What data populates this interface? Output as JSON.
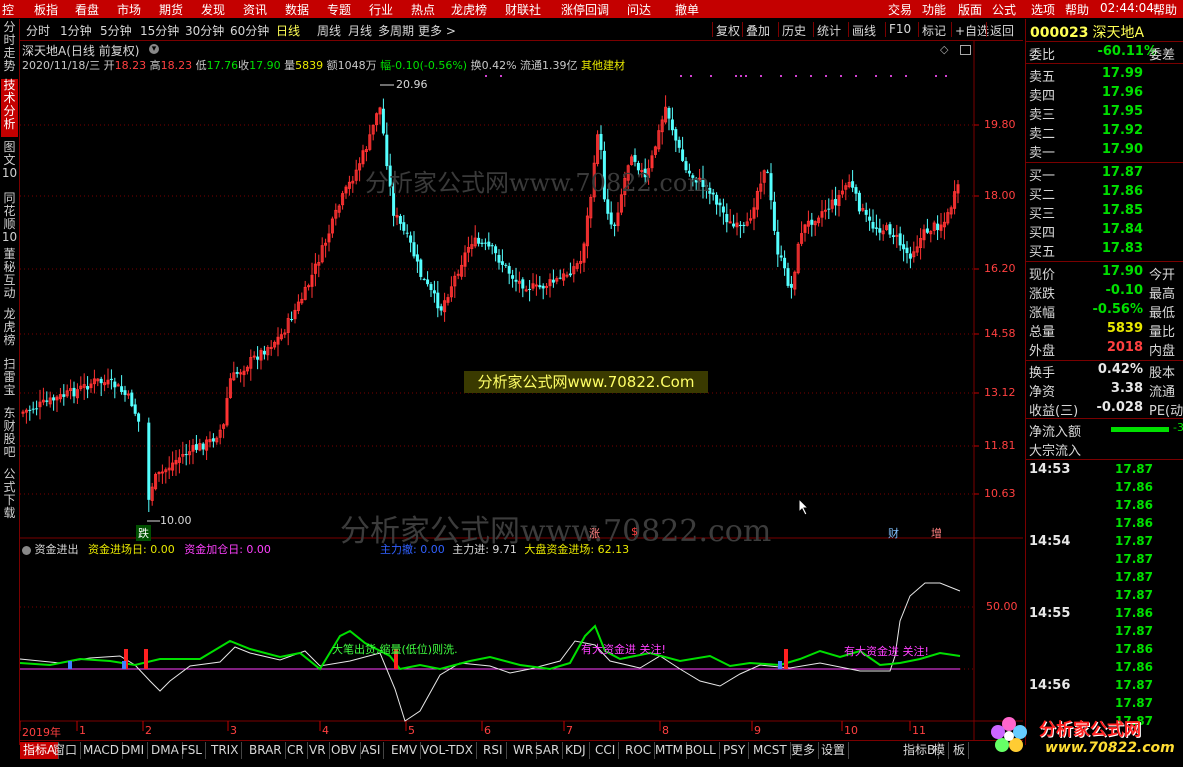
{
  "top_menu": [
    "控",
    "板指",
    "看盘",
    "市场",
    "期货",
    "发现",
    "资讯",
    "数据",
    "专题",
    "行业",
    "热点",
    "龙虎榜",
    "财联社",
    "涨停回调",
    "问达",
    "撤单",
    "交易",
    "功能",
    "版面",
    "公式",
    "选项",
    "帮助",
    "02:44:04",
    "帮助"
  ],
  "toolbar": {
    "periods": [
      "分时",
      "1分钟",
      "5分钟",
      "15分钟",
      "30分钟",
      "60分钟",
      "日线",
      "周线",
      "月线",
      "多周期",
      "更多 >"
    ],
    "active_period": "日线",
    "actions": [
      "复权",
      "叠加",
      "历史",
      "统计",
      "画线",
      "F10",
      "标记",
      "+自选",
      "返回"
    ]
  },
  "left_tabs": [
    {
      "label": "分时走势",
      "active": false
    },
    {
      "label": "技术分析",
      "active": true
    },
    {
      "label": "图文10",
      "active": false
    },
    {
      "label": "同花顺10",
      "active": false
    },
    {
      "label": "董秘互动",
      "active": false
    },
    {
      "label": "龙虎榜",
      "active": false
    },
    {
      "label": "扫雷宝",
      "active": false
    },
    {
      "label": "东财股吧",
      "active": false
    },
    {
      "label": "公式下载",
      "active": false
    }
  ],
  "chart_header": {
    "stock": "深天地A(日线 前复权)",
    "date": "2020/11/18/三",
    "open_label": "开",
    "open": "18.23",
    "high_label": "高",
    "high": "18.23",
    "low_label": "低",
    "low": "17.76",
    "close_label": "收",
    "close": "17.90",
    "vol_label": "量",
    "volume": "5839",
    "amount": "额1048万",
    "change": "幅-0.10(-0.56%)",
    "turnover": "换0.42%",
    "float_cap": "流通1.39亿",
    "other": "其他建材"
  },
  "watermark_center": "分析家公式网www.70822.Com",
  "watermark_big": "分析家公式网www.70822.com",
  "watermark_upper": "分析家公式网www.70822.com",
  "price_labels": {
    "max": "20.96",
    "min": "10.00"
  },
  "event_marks": {
    "die": "跌",
    "zhang": "涨",
    "s": "$",
    "cai": "财",
    "zeng": "增"
  },
  "indicator_header": {
    "name": "资金进出",
    "entry_day": "资金进场日: 0.00",
    "add_day": "资金加仓日: 0.00",
    "main_sell": "主力撤: 0.00",
    "main_in": "主力进: 9.71",
    "market_in": "大盘资金进场: 62.13"
  },
  "indicator_texts": {
    "t1": "大笔出货,缩量(低位)则洗.",
    "t2": "有大资金进 关注!",
    "t3": "有大资金进 关注!"
  },
  "indicator_axis": "50.00",
  "price_axis": [
    "19.80",
    "18.00",
    "16.20",
    "14.58",
    "13.12",
    "11.81",
    "10.63"
  ],
  "x_axis": [
    "2019年",
    "1",
    "2",
    "3",
    "4",
    "5",
    "6",
    "7",
    "8",
    "9",
    "10",
    "11"
  ],
  "bottom_tabs": [
    "指标A",
    "窗口",
    "MACD",
    "DMI",
    "DMA",
    "FSL",
    "TRIX",
    "BRAR",
    "CR",
    "VR",
    "OBV",
    "ASI",
    "EMV",
    "VOL-TDX",
    "RSI",
    "WR",
    "SAR",
    "KDJ",
    "CCI",
    "ROC",
    "MTM",
    "BOLL",
    "PSY",
    "MCST",
    "更多",
    "设置",
    "指标B",
    "模",
    "板"
  ],
  "right_panel": {
    "code": "000023",
    "name": "深天地A",
    "webi_label": "委比",
    "webi": "-60.11%",
    "webi_ex": "委差",
    "asks": [
      {
        "label": "卖五",
        "price": "17.99"
      },
      {
        "label": "卖四",
        "price": "17.96"
      },
      {
        "label": "卖三",
        "price": "17.95"
      },
      {
        "label": "卖二",
        "price": "17.92"
      },
      {
        "label": "卖一",
        "price": "17.90"
      }
    ],
    "bids": [
      {
        "label": "买一",
        "price": "17.87"
      },
      {
        "label": "买二",
        "price": "17.86"
      },
      {
        "label": "买三",
        "price": "17.85"
      },
      {
        "label": "买四",
        "price": "17.84"
      },
      {
        "label": "买五",
        "price": "17.83"
      }
    ],
    "stats": [
      {
        "label": "现价",
        "value": "17.90",
        "ex": "今开",
        "color": "#00e000"
      },
      {
        "label": "涨跌",
        "value": "-0.10",
        "ex": "最高",
        "color": "#00e000"
      },
      {
        "label": "涨幅",
        "value": "-0.56%",
        "ex": "最低",
        "color": "#00e000"
      },
      {
        "label": "总量",
        "value": "5839",
        "ex": "量比",
        "color": "#e8e800"
      },
      {
        "label": "外盘",
        "value": "2018",
        "ex": "内盘",
        "color": "#ff4040"
      }
    ],
    "stats2": [
      {
        "label": "换手",
        "value": "0.42%",
        "ex": "股本",
        "color": "#e8e8e8"
      },
      {
        "label": "净资",
        "value": "3.38",
        "ex": "流通",
        "color": "#e8e8e8"
      },
      {
        "label": "收益(三)",
        "value": "-0.028",
        "ex": "PE(动",
        "color": "#e8e8e8"
      }
    ],
    "netflow_label": "净流入额",
    "netflow_val": "-3",
    "bigorder_label": "大宗流入",
    "ticks": [
      {
        "time": "14:53",
        "prices": [
          "17.87",
          "17.86",
          "17.86",
          "17.86"
        ]
      },
      {
        "time": "14:54",
        "prices": [
          "17.87",
          "17.87",
          "17.87",
          "17.87"
        ]
      },
      {
        "time": "14:55",
        "prices": [
          "17.86",
          "17.87",
          "17.86",
          "17.86"
        ]
      },
      {
        "time": "14:56",
        "prices": [
          "17.87",
          "17.87",
          "17.87"
        ]
      }
    ]
  },
  "logo": {
    "text": "分析家公式网",
    "url": "www.70822.com"
  },
  "colors": {
    "accent": "#c40000",
    "up": "#ff3232",
    "down": "#54ffff",
    "green": "#00e000",
    "yellow": "#e8e800",
    "magenta": "#ff00ff"
  }
}
